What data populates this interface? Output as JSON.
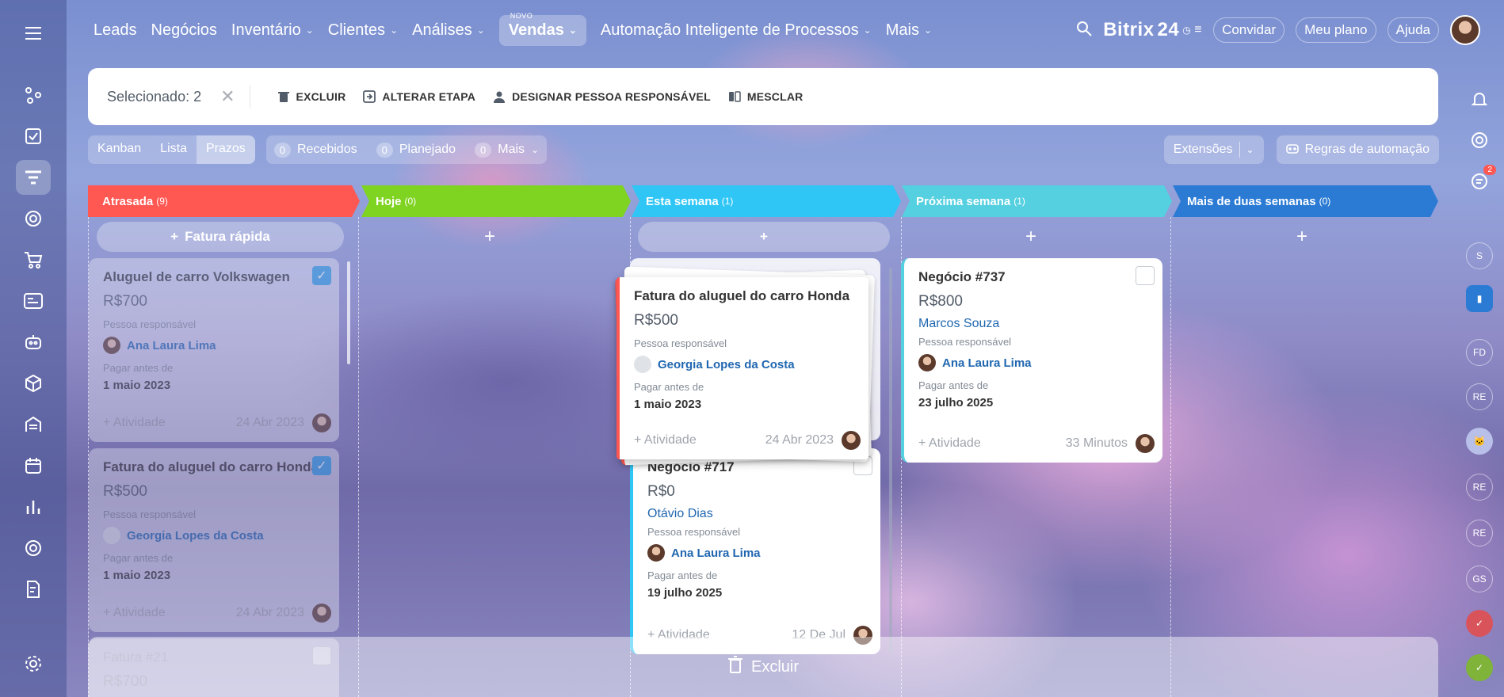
{
  "nav": {
    "items": [
      {
        "label": "Leads",
        "chev": false
      },
      {
        "label": "Negócios",
        "chev": false
      },
      {
        "label": "Inventário",
        "chev": true
      },
      {
        "label": "Clientes",
        "chev": true
      },
      {
        "label": "Análises",
        "chev": true
      },
      {
        "label": "Vendas",
        "chev": true,
        "active": true,
        "badge": "NOVO"
      },
      {
        "label": "Automação Inteligente de Processos",
        "chev": true
      },
      {
        "label": "Mais",
        "chev": true
      }
    ],
    "logo": "Bitrix",
    "logo_num": "24",
    "invite": "Convidar",
    "plan": "Meu plano",
    "help": "Ajuda"
  },
  "selection": {
    "count": "Selecionado: 2",
    "delete": "EXCLUIR",
    "change_stage": "ALTERAR ETAPA",
    "assign": "DESIGNAR PESSOA RESPONSÁVEL",
    "merge": "MESCLAR"
  },
  "views": {
    "kanban": "Kanban",
    "list": "Lista",
    "deadlines": "Prazos"
  },
  "filters": {
    "received_count": "0",
    "received": "Recebidos",
    "planned_count": "0",
    "planned": "Planejado",
    "more_count": "0",
    "more": "Mais"
  },
  "toolbar": {
    "extensions": "Extensões",
    "automation": "Regras de automação"
  },
  "columns": [
    {
      "title": "Atrasada",
      "count": "(9)",
      "color": "#ff5752"
    },
    {
      "title": "Hoje",
      "count": "(0)",
      "color": "#7fd321"
    },
    {
      "title": "Esta semana",
      "count": "(1)",
      "color": "#2fc6f6"
    },
    {
      "title": "Próxima semana",
      "count": "(1)",
      "color": "#55d0e0"
    },
    {
      "title": "Mais de duas semanas",
      "count": "(0)",
      "color": "#2b7bd4"
    }
  ],
  "quick_invoice": "Fatura rápida",
  "cards": {
    "c1": {
      "title": "Aluguel de carro Volkswagen",
      "amount": "R$700",
      "resp_label": "Pessoa responsável",
      "person": "Ana Laura Lima",
      "due_label": "Pagar antes de",
      "due": "1 maio 2023",
      "activity": "+ Atividade",
      "date": "24 Abr 2023"
    },
    "c2": {
      "title": "Fatura do aluguel do carro Honda",
      "amount": "R$500",
      "resp_label": "Pessoa responsável",
      "person": "Georgia Lopes da Costa",
      "due_label": "Pagar antes de",
      "due": "1 maio 2023",
      "activity": "+ Atividade",
      "date": "24 Abr 2023"
    },
    "c3": {
      "title": "Fatura #21",
      "amount": "R$700"
    },
    "drag": {
      "title": "Fatura do aluguel do carro Honda",
      "amount": "R$500",
      "resp_label": "Pessoa responsável",
      "person": "Georgia Lopes da Costa",
      "due_label": "Pagar antes de",
      "due": "1 maio 2023",
      "activity": "+ Atividade",
      "date": "24 Abr 2023"
    },
    "c717": {
      "title": "Negócio #717",
      "amount": "R$0",
      "client": "Otávio Dias",
      "resp_label": "Pessoa responsável",
      "person": "Ana Laura Lima",
      "due_label": "Pagar antes de",
      "due": "19 julho 2025",
      "activity": "+ Atividade",
      "date": "12 De Jul"
    },
    "c737": {
      "title": "Negócio #737",
      "amount": "R$800",
      "client": "Marcos Souza",
      "resp_label": "Pessoa responsável",
      "person": "Ana Laura Lima",
      "due_label": "Pagar antes de",
      "due": "23 julho 2025",
      "activity": "+ Atividade",
      "date": "33 Minutos"
    }
  },
  "trash": "Excluir",
  "right_panel": {
    "chat_badge": "2",
    "initials": [
      "S",
      "FD",
      "RE",
      "RE",
      "RE",
      "GS"
    ]
  }
}
